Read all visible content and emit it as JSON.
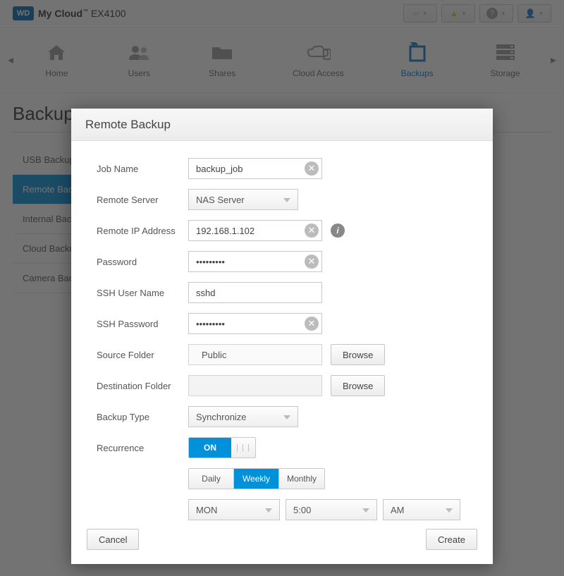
{
  "header": {
    "brand_badge": "WD",
    "product_name_a": "My Cloud",
    "product_name_b": "EX4100",
    "help_badge": "?"
  },
  "nav": {
    "items": [
      {
        "label": "Home"
      },
      {
        "label": "Users"
      },
      {
        "label": "Shares"
      },
      {
        "label": "Cloud Access"
      },
      {
        "label": "Backups"
      },
      {
        "label": "Storage"
      }
    ]
  },
  "page": {
    "title": "Backups"
  },
  "tabs": [
    "USB Backups",
    "Remote Backups",
    "Internal Backups",
    "Cloud Backups",
    "Camera Backups"
  ],
  "modal": {
    "title": "Remote Backup",
    "labels": {
      "job_name": "Job Name",
      "remote_server": "Remote Server",
      "remote_ip": "Remote IP Address",
      "password": "Password",
      "ssh_user": "SSH User Name",
      "ssh_password": "SSH Password",
      "source_folder": "Source Folder",
      "dest_folder": "Destination Folder",
      "backup_type": "Backup Type",
      "recurrence": "Recurrence"
    },
    "values": {
      "job_name": "backup_job",
      "remote_server": "NAS Server",
      "remote_ip": "192.168.1.102",
      "password": "•••••••••",
      "ssh_user": "sshd",
      "ssh_password": "•••••••••",
      "source_folder": "Public",
      "dest_folder": "",
      "backup_type": "Synchronize",
      "toggle_on": "ON",
      "toggle_off": "| | |",
      "freq_daily": "Daily",
      "freq_weekly": "Weekly",
      "freq_monthly": "Monthly",
      "day": "MON",
      "hour": "5:00",
      "ampm": "AM"
    },
    "buttons": {
      "browse": "Browse",
      "cancel": "Cancel",
      "create": "Create"
    },
    "clear_glyph": "✕"
  }
}
